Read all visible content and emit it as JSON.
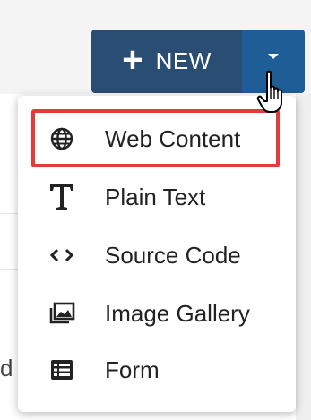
{
  "header": {
    "new_button_label": "NEW",
    "new_button_plus": "+",
    "dropdown_toggle_icon": "caret-down-icon"
  },
  "background": {
    "partial_text": "d"
  },
  "menu": {
    "items": [
      {
        "label": "Web Content",
        "icon": "globe-icon"
      },
      {
        "label": "Plain Text",
        "icon": "text-icon"
      },
      {
        "label": "Source Code",
        "icon": "code-icon"
      },
      {
        "label": "Image Gallery",
        "icon": "image-gallery-icon"
      },
      {
        "label": "Form",
        "icon": "form-icon"
      }
    ],
    "highlighted_index": 0
  },
  "colors": {
    "button_main": "#2a4d74",
    "button_caret": "#1f5d96",
    "highlight_border": "#e03c3c",
    "menu_text": "#222222"
  }
}
